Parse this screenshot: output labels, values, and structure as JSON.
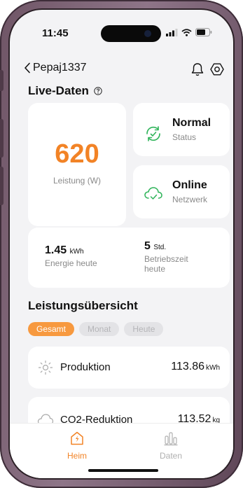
{
  "status_bar": {
    "time": "11:45"
  },
  "header": {
    "back_label": "Pepaj1337"
  },
  "live": {
    "title": "Live-Daten",
    "power_value": "620",
    "power_label": "Leistung (W)",
    "status_value": "Normal",
    "status_label": "Status",
    "network_value": "Online",
    "network_label": "Netzwerk",
    "energy_value": "1.45",
    "energy_unit": "kWh",
    "energy_label": "Energie heute",
    "runtime_value": "5",
    "runtime_unit": "Std.",
    "runtime_label": "Betriebszeit heute"
  },
  "overview": {
    "title": "Leistungsübersicht",
    "tabs": [
      "Gesamt",
      "Monat",
      "Heute"
    ],
    "active_tab": "Gesamt",
    "production_label": "Produktion",
    "production_value": "113.86",
    "production_unit": "kWh",
    "co2_label": "CO2-Reduktion",
    "co2_value": "113.52",
    "co2_unit": "kg"
  },
  "nav": {
    "home_label": "Heim",
    "data_label": "Daten"
  },
  "colors": {
    "accent": "#f28326",
    "status_green": "#2fb45a",
    "inactive_nav": "#b0b0b0"
  },
  "icons": [
    "back-chevron-icon",
    "bell-icon",
    "settings-hexagon-icon",
    "help-circle-icon",
    "sync-check-icon",
    "cloud-check-icon",
    "sun-icon",
    "cloud-icon",
    "home-icon",
    "data-bars-icon"
  ]
}
